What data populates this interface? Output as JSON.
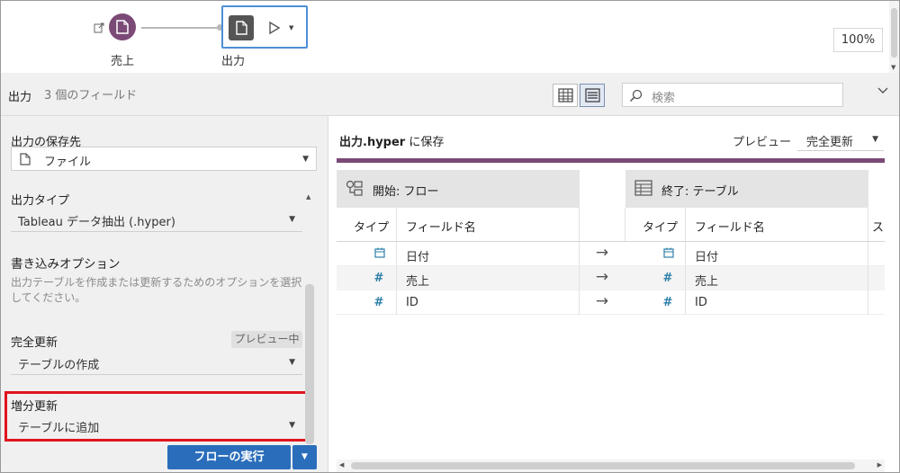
{
  "flow": {
    "input_node_label": "売上",
    "output_node_label": "出力",
    "zoom": "100%"
  },
  "header": {
    "title": "出力",
    "field_count": "3 個のフィールド",
    "search_placeholder": "検索"
  },
  "settings": {
    "save_to_label": "出力の保存先",
    "save_to_value": "ファイル",
    "output_type_label": "出力タイプ",
    "output_type_value": "Tableau データ抽出 (.hyper)",
    "write_options_label": "書き込みオプション",
    "write_options_desc": "出力テーブルを作成または更新するためのオプションを選択してください。",
    "full_refresh_label": "完全更新",
    "preview_badge": "プレビュー中",
    "full_refresh_value": "テーブルの作成",
    "incremental_label": "増分更新",
    "incremental_value": "テーブルに追加",
    "run_button": "フローの実行"
  },
  "preview": {
    "file_name": "出力.hyper",
    "save_suffix": " に保存",
    "preview_label": "プレビュー",
    "preview_mode": "完全更新",
    "source_group": "開始: フロー",
    "target_group": "終了: テーブル",
    "col_type": "タイプ",
    "col_field": "フィールド名",
    "col_extra": "ス",
    "rows": [
      {
        "src_type": "date",
        "src_name": "日付",
        "tgt_type": "date",
        "tgt_name": "日付"
      },
      {
        "src_type": "number",
        "src_name": "売上",
        "tgt_type": "number",
        "tgt_name": "売上"
      },
      {
        "src_type": "number",
        "src_name": "ID",
        "tgt_type": "number",
        "tgt_name": "ID"
      }
    ]
  }
}
